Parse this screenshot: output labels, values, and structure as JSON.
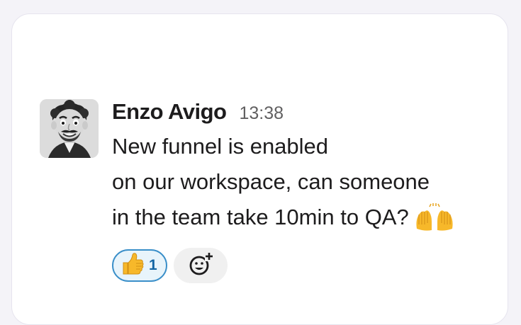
{
  "message": {
    "author": "Enzo Avigo",
    "timestamp": "13:38",
    "lines": [
      "New funnel is enabled",
      "on our workspace, can someone",
      "in the team take 10min to QA?"
    ],
    "inline_emoji": "raising-hands-emoji"
  },
  "reactions": [
    {
      "emoji": "thumbs-up-emoji",
      "count": "1",
      "selected": true
    }
  ],
  "add_reaction_icon": "add-reaction-icon",
  "colors": {
    "accent_border": "#3a8fc9",
    "accent_text": "#1264a3"
  }
}
